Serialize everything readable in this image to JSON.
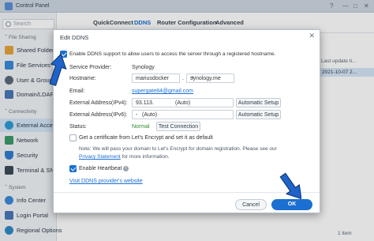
{
  "window": {
    "title": "Control Panel"
  },
  "sidebar": {
    "search_placeholder": "Search",
    "sections": [
      {
        "label": "File Sharing"
      },
      {
        "label": "Connectivity"
      },
      {
        "label": "System"
      }
    ],
    "items": [
      {
        "label": "Shared Folder"
      },
      {
        "label": "File Services"
      },
      {
        "label": "User & Group"
      },
      {
        "label": "Domain/LDAP"
      },
      {
        "label": "External Access"
      },
      {
        "label": "Network"
      },
      {
        "label": "Security"
      },
      {
        "label": "Terminal & SNMP"
      },
      {
        "label": "Info Center"
      },
      {
        "label": "Login Portal"
      },
      {
        "label": "Regional Options"
      }
    ]
  },
  "tabs": [
    {
      "label": "QuickConnect"
    },
    {
      "label": "DDNS"
    },
    {
      "label": "Router Configuration"
    },
    {
      "label": "Advanced"
    }
  ],
  "background": {
    "column_header": "Last update ti...",
    "row_value": "2021-10-07 2...",
    "footer_count": "1 item"
  },
  "dialog": {
    "title": "Edit DDNS",
    "enable_label": "Enable DDNS support to allow users to access the server through a registered hostname.",
    "service_provider_label": "Service Provider:",
    "service_provider_value": "Synology",
    "hostname_label": "Hostname:",
    "hostname_value": "mariusdocker",
    "hostname_domain": "synology.me",
    "email_label": "Email:",
    "email_value": "supergate84@gmail.com",
    "ipv4_label": "External Address(IPv4):",
    "ipv4_value": "93.113.",
    "ipv4_mode": "(Auto)",
    "ipv6_label": "External Address(IPv6):",
    "ipv6_value": "-",
    "ipv6_mode": "(Auto)",
    "auto_setup_label": "Automatic Setup",
    "status_label": "Status:",
    "status_value": "Normal",
    "test_connection_label": "Test Connection",
    "cert_label": "Get a certificate from Let's Encrypt and set it as default",
    "note_prefix": "Note: We will pass your domain to Let's Encrypt for domain registration. Please see our",
    "privacy_link": "Privacy Statement",
    "note_suffix": "for more information.",
    "heartbeat_label": "Enable Heartbeat",
    "visit_link": "Visit DDNS provider's website",
    "cancel_label": "Cancel",
    "ok_label": "OK"
  },
  "colors": {
    "accent": "#1b6fd1",
    "arrow": "#1e63c9",
    "status_normal": "#2e8b2e"
  }
}
